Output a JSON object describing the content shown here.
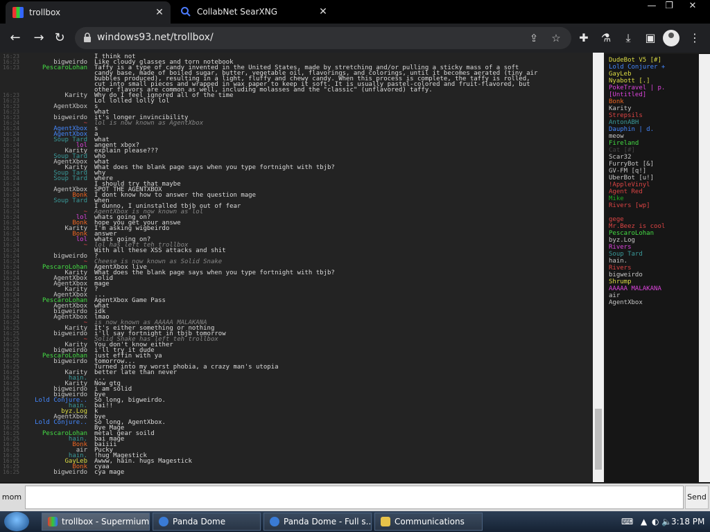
{
  "browser": {
    "tabs": [
      {
        "title": "trollbox",
        "active": true
      },
      {
        "title": "CollabNet SearXNG",
        "active": false
      }
    ],
    "url": "windows93.net/trollbox/"
  },
  "chat": {
    "messages": [
      {
        "time": "16:23",
        "nick": "",
        "nick_color": "#4466dd",
        "text": "I think not"
      },
      {
        "time": "16:23",
        "nick": "bigweirdo",
        "nick_color": "#c8c8c8",
        "text": "Like cloudy glasses and torn notebook"
      },
      {
        "time": "16:23",
        "nick": "PescaroLohan",
        "nick_color": "#44dd44",
        "text": "Taffy is a type of candy invented in the United States, made by stretching and/or pulling a sticky mass of a soft"
      },
      {
        "time": "",
        "nick": "",
        "nick_color": "#c8c8c8",
        "text": "candy base, made of boiled sugar, butter, vegetable oil, flavorings, and colorings, until it becomes aerated (tiny air"
      },
      {
        "time": "",
        "nick": "",
        "nick_color": "#c8c8c8",
        "text": "bubbles produced), resulting in a light, fluffy and chewy candy. When this process is complete, the taffy is rolled,"
      },
      {
        "time": "",
        "nick": "",
        "nick_color": "#c8c8c8",
        "text": "cut into small pieces and wrapped in wax paper to keep it soft. It is usually pastel-colored and fruit-flavored, but"
      },
      {
        "time": "",
        "nick": "",
        "nick_color": "#c8c8c8",
        "text": "other flavors are common as well, including molasses and the \"classic\" (unflavored) taffy."
      },
      {
        "time": "16:23",
        "nick": "Karity",
        "nick_color": "#c8c8c8",
        "text": "Why do I feel ignored all of the time"
      },
      {
        "time": "16:23",
        "nick": "",
        "nick_color": "#dd44dd",
        "text": "Lol lolled lolly lol"
      },
      {
        "time": "16:23",
        "nick": "AgentXbox",
        "nick_color": "#c8c8c8",
        "text": "s"
      },
      {
        "time": "16:23",
        "nick": "",
        "nick_color": "#dd44dd",
        "text": "what"
      },
      {
        "time": "16:23",
        "nick": "bigweirdo",
        "nick_color": "#c8c8c8",
        "text": "it's longer invincibility"
      },
      {
        "time": "16:24",
        "nick": "~",
        "nick_color": "#dd4444",
        "text": "lol is now known as AgentXbox",
        "sys": true
      },
      {
        "time": "16:24",
        "nick": "AgentXbox",
        "nick_color": "#4488ff",
        "text": "s"
      },
      {
        "time": "16:24",
        "nick": "AgentXbox",
        "nick_color": "#4488ff",
        "text": "a"
      },
      {
        "time": "16:24",
        "nick": "Soup Tard",
        "nick_color": "#3a9a9a",
        "text": "what"
      },
      {
        "time": "16:24",
        "nick": "lol",
        "nick_color": "#dd44dd",
        "text": "angent xbox?"
      },
      {
        "time": "16:24",
        "nick": "Karity",
        "nick_color": "#c8c8c8",
        "text": "explain please???"
      },
      {
        "time": "16:24",
        "nick": "Soup Tard",
        "nick_color": "#3a9a9a",
        "text": "who"
      },
      {
        "time": "16:24",
        "nick": "AgentXbox",
        "nick_color": "#c8c8c8",
        "text": "what"
      },
      {
        "time": "16:24",
        "nick": "Karity",
        "nick_color": "#c8c8c8",
        "text": "What does the blank page says when you type fortnight with tbjb?"
      },
      {
        "time": "16:24",
        "nick": "Soup Tard",
        "nick_color": "#3a9a9a",
        "text": "why"
      },
      {
        "time": "16:24",
        "nick": "Soup Tard",
        "nick_color": "#3a9a9a",
        "text": "where"
      },
      {
        "time": "16:24",
        "nick": "",
        "nick_color": "#4466dd",
        "text": "I should try that maybe"
      },
      {
        "time": "16:24",
        "nick": "AgentXbox",
        "nick_color": "#c8c8c8",
        "text": "SPOT THE AGENTXBOX"
      },
      {
        "time": "16:24",
        "nick": "Bonk",
        "nick_color": "#ee6622",
        "text": "I dont know how to answer the question mage"
      },
      {
        "time": "16:24",
        "nick": "Soup Tard",
        "nick_color": "#3a9a9a",
        "text": "when"
      },
      {
        "time": "16:24",
        "nick": "",
        "nick_color": "#4466dd",
        "text": "I dunno, I uninstalled tbjb out of fear"
      },
      {
        "time": "16:24",
        "nick": "~",
        "nick_color": "#dd4444",
        "text": "AgentXbox is now known as lol",
        "sys": true
      },
      {
        "time": "16:24",
        "nick": "lol",
        "nick_color": "#dd44dd",
        "text": "whats going on?"
      },
      {
        "time": "16:24",
        "nick": "Bonk",
        "nick_color": "#ee6622",
        "text": "hope you get your answe"
      },
      {
        "time": "16:24",
        "nick": "Karity",
        "nick_color": "#c8c8c8",
        "text": "I'm asking wigbeirdo"
      },
      {
        "time": "16:24",
        "nick": "Bonk",
        "nick_color": "#ee6622",
        "text": "answer"
      },
      {
        "time": "16:24",
        "nick": "lol",
        "nick_color": "#dd44dd",
        "text": "whats going on?"
      },
      {
        "time": "16:24",
        "nick": "~",
        "nick_color": "#dd4444",
        "text": "lol has left teh trollbox",
        "sys": true
      },
      {
        "time": "16:24",
        "nick": "",
        "nick_color": "#4466dd",
        "text": "With all these XSS attacks and shit"
      },
      {
        "time": "16:24",
        "nick": "bigweirdo",
        "nick_color": "#c8c8c8",
        "text": "?"
      },
      {
        "time": "16:24",
        "nick": "~",
        "nick_color": "#dd4444",
        "text": "Cheese is now known as Solid Snake",
        "sys": true
      },
      {
        "time": "16:24",
        "nick": "PescaroLohan",
        "nick_color": "#44dd44",
        "text": "AgentXbox live"
      },
      {
        "time": "16:24",
        "nick": "Karity",
        "nick_color": "#c8c8c8",
        "text": "What does the blank page says when you type fortnight with tbjb?"
      },
      {
        "time": "16:24",
        "nick": "AgentXbox",
        "nick_color": "#c8c8c8",
        "text": "solid"
      },
      {
        "time": "16:24",
        "nick": "AgentXbox",
        "nick_color": "#c8c8c8",
        "text": "mage"
      },
      {
        "time": "16:24",
        "nick": "Karity",
        "nick_color": "#c8c8c8",
        "text": "?"
      },
      {
        "time": "16:24",
        "nick": "AgentXbox",
        "nick_color": "#c8c8c8",
        "text": "..."
      },
      {
        "time": "16:24",
        "nick": "PescaroLohan",
        "nick_color": "#44dd44",
        "text": "AgentXbox Game Pass"
      },
      {
        "time": "16:24",
        "nick": "AgentXbox",
        "nick_color": "#c8c8c8",
        "text": "what"
      },
      {
        "time": "16:24",
        "nick": "bigweirdo",
        "nick_color": "#c8c8c8",
        "text": "idk"
      },
      {
        "time": "16:24",
        "nick": "AgentXbox",
        "nick_color": "#c8c8c8",
        "text": "lmao"
      },
      {
        "time": "16:25",
        "nick": "~",
        "nick_color": "#dd4444",
        "text": "is now known as AAAAA MALAKANA",
        "sys": true
      },
      {
        "time": "16:25",
        "nick": "Karity",
        "nick_color": "#c8c8c8",
        "text": "It's either something or nothing"
      },
      {
        "time": "16:25",
        "nick": "bigweirdo",
        "nick_color": "#c8c8c8",
        "text": "i'll say fortnight in tbjb tomorrow"
      },
      {
        "time": "16:25",
        "nick": "~",
        "nick_color": "#dd4444",
        "text": "Solid Snake has left teh trollbox",
        "sys": true
      },
      {
        "time": "16:25",
        "nick": "Karity",
        "nick_color": "#c8c8c8",
        "text": "You don't know either"
      },
      {
        "time": "16:25",
        "nick": "bigweirdo",
        "nick_color": "#c8c8c8",
        "text": "i'll try it dude"
      },
      {
        "time": "16:25",
        "nick": "PescaroLohan",
        "nick_color": "#44dd44",
        "text": "just effin with ya"
      },
      {
        "time": "16:25",
        "nick": "bigweirdo",
        "nick_color": "#c8c8c8",
        "text": "tomorrow..."
      },
      {
        "time": "16:25",
        "nick": "",
        "nick_color": "#4466dd",
        "text": "Turned into my worst phobia, a crazy man's utopia"
      },
      {
        "time": "16:25",
        "nick": "Karity",
        "nick_color": "#c8c8c8",
        "text": "better late than never"
      },
      {
        "time": "16:25",
        "nick": "hain.",
        "nick_color": "#3a9a9a",
        "text": "..."
      },
      {
        "time": "16:25",
        "nick": "Karity",
        "nick_color": "#c8c8c8",
        "text": "Now gtg"
      },
      {
        "time": "16:25",
        "nick": "bigweirdo",
        "nick_color": "#c8c8c8",
        "text": "i am solid"
      },
      {
        "time": "16:25",
        "nick": "bigweirdo",
        "nick_color": "#c8c8c8",
        "text": "bye"
      },
      {
        "time": "16:25",
        "nick": "Lold Conjure..",
        "nick_color": "#4488ff",
        "text": "So long, bigweirdo."
      },
      {
        "time": "16:25",
        "nick": "hain.",
        "nick_color": "#3a9a9a",
        "text": "bai!!"
      },
      {
        "time": "16:25",
        "nick": "byz.Log",
        "nick_color": "#dddd44",
        "text": "k"
      },
      {
        "time": "16:25",
        "nick": "AgentXbox",
        "nick_color": "#c8c8c8",
        "text": "bye"
      },
      {
        "time": "16:25",
        "nick": "Lold Conjure..",
        "nick_color": "#4488ff",
        "text": "So long, AgentXbox."
      },
      {
        "time": "16:25",
        "nick": "",
        "nick_color": "#4466dd",
        "text": "Bye Mage"
      },
      {
        "time": "16:25",
        "nick": "PescaroLohan",
        "nick_color": "#44dd44",
        "text": "metal gear soild"
      },
      {
        "time": "16:25",
        "nick": "hain.",
        "nick_color": "#3a9a9a",
        "text": "bai mage"
      },
      {
        "time": "16:25",
        "nick": "Bonk",
        "nick_color": "#ee6622",
        "text": "baiiii"
      },
      {
        "time": "16:25",
        "nick": "air",
        "nick_color": "#c8c8c8",
        "text": "Pucky"
      },
      {
        "time": "16:25",
        "nick": "hain.",
        "nick_color": "#3a9a9a",
        "text": "!hug Magestick"
      },
      {
        "time": "16:25",
        "nick": "GayLeb",
        "nick_color": "#dddd44",
        "text": "Awww, hain. hugs Magestick"
      },
      {
        "time": "16:25",
        "nick": "Bonk",
        "nick_color": "#ee6622",
        "text": "cyaa"
      },
      {
        "time": "16:25",
        "nick": "bigweirdo",
        "nick_color": "#c8c8c8",
        "text": "cya mage"
      }
    ]
  },
  "users": [
    {
      "name": "DudeBot V5 [#]",
      "color": "#dddd44"
    },
    {
      "name": "Lold Conjurer +",
      "color": "#4488ff"
    },
    {
      "name": "GayLeb",
      "color": "#dddd44"
    },
    {
      "name": "Nyabott [.]",
      "color": "#dddd44"
    },
    {
      "name": "PokeTravel | p.",
      "color": "#dd44dd"
    },
    {
      "name": "[Untitled]",
      "color": "#dd44dd"
    },
    {
      "name": "Bonk",
      "color": "#ee6622"
    },
    {
      "name": "Karity",
      "color": "#c8c8c8"
    },
    {
      "name": "Strepsils",
      "color": "#dd4444"
    },
    {
      "name": "AntonABH",
      "color": "#3a9a9a"
    },
    {
      "name": "Dauphin | d.",
      "color": "#4488ff"
    },
    {
      "name": "meow",
      "color": "#c8c8c8"
    },
    {
      "name": "Fireland",
      "color": "#44dd44"
    },
    {
      "name": "Cat [#]",
      "color": "#444444"
    },
    {
      "name": "Scar32",
      "color": "#c8c8c8"
    },
    {
      "name": "FurryBot [&]",
      "color": "#c8c8c8"
    },
    {
      "name": "GV-FM [q!]",
      "color": "#c8c8c8"
    },
    {
      "name": "UberBot [u!]",
      "color": "#c8c8c8"
    },
    {
      "name": "!AppleVinyl",
      "color": "#dd4444"
    },
    {
      "name": "Agent Red",
      "color": "#dd4444"
    },
    {
      "name": "Mike",
      "color": "#22aa22"
    },
    {
      "name": "Rivers [wp]",
      "color": "#dd4444"
    },
    {
      "name": "",
      "color": "#4466dd"
    },
    {
      "name": "gege",
      "color": "#dd4444"
    },
    {
      "name": "Mr.Beez is cool",
      "color": "#dd4444"
    },
    {
      "name": "PescaroLohan",
      "color": "#44dd44"
    },
    {
      "name": "byz.Log",
      "color": "#c8c8c8"
    },
    {
      "name": "Rivers",
      "color": "#dd44dd"
    },
    {
      "name": "Soup Tard",
      "color": "#3a9a9a"
    },
    {
      "name": "hain.",
      "color": "#c8c8c8"
    },
    {
      "name": "Rivers",
      "color": "#dd4444"
    },
    {
      "name": "bigweirdo",
      "color": "#c8c8c8"
    },
    {
      "name": "Shrump",
      "color": "#dddd44"
    },
    {
      "name": "AAAAA MALAKANA",
      "color": "#dd44dd"
    },
    {
      "name": "air",
      "color": "#c8c8c8"
    },
    {
      "name": "AgentXbox",
      "color": "#c8c8c8"
    }
  ],
  "input": {
    "nick": "mom",
    "value": "",
    "send_label": "Send"
  },
  "taskbar": {
    "tasks": [
      {
        "label": "trollbox - Supermium",
        "active": true
      },
      {
        "label": "Panda Dome",
        "active": false
      },
      {
        "label": "Panda Dome - Full s...",
        "active": false
      },
      {
        "label": "Communications",
        "active": false
      }
    ],
    "clock": "3:18 PM"
  },
  "colors": {
    "chat_bg": "#232323",
    "users_bg": "#161616",
    "accent": "#4488ff"
  }
}
